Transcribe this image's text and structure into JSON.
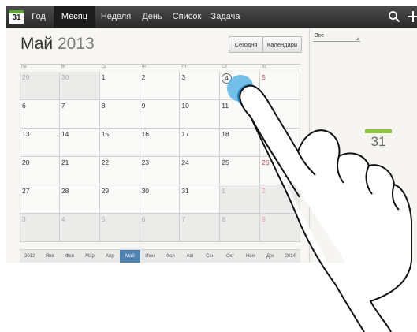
{
  "app": {
    "icon_day": "31"
  },
  "tabs": [
    {
      "label": "Год"
    },
    {
      "label": "Месяц",
      "active": true
    },
    {
      "label": "Неделя"
    },
    {
      "label": "День"
    },
    {
      "label": "Список"
    },
    {
      "label": "Задача"
    }
  ],
  "toolbar": {
    "search_icon": "search-icon",
    "add_icon": "plus-icon"
  },
  "calendar": {
    "month": "Май",
    "year": "2013",
    "today_button": "Сегодня",
    "calendars_button": "Календари",
    "weekdays": [
      "Пн",
      "Вт",
      "Ср",
      "Чт",
      "Пт",
      "Сб",
      "Вс"
    ],
    "weeks": [
      [
        {
          "d": "29",
          "other": true
        },
        {
          "d": "30",
          "other": true
        },
        {
          "d": "1"
        },
        {
          "d": "2"
        },
        {
          "d": "3"
        },
        {
          "d": "4",
          "today": true
        },
        {
          "d": "5",
          "sunday": true
        }
      ],
      [
        {
          "d": "6"
        },
        {
          "d": "7"
        },
        {
          "d": "8"
        },
        {
          "d": "9"
        },
        {
          "d": "10"
        },
        {
          "d": "11"
        },
        {
          "d": "12",
          "sunday": true
        }
      ],
      [
        {
          "d": "13"
        },
        {
          "d": "14"
        },
        {
          "d": "15"
        },
        {
          "d": "16"
        },
        {
          "d": "17"
        },
        {
          "d": "18"
        },
        {
          "d": "19",
          "sunday": true
        }
      ],
      [
        {
          "d": "20"
        },
        {
          "d": "21"
        },
        {
          "d": "22"
        },
        {
          "d": "23"
        },
        {
          "d": "24"
        },
        {
          "d": "25"
        },
        {
          "d": "26",
          "sunday": true
        }
      ],
      [
        {
          "d": "27"
        },
        {
          "d": "28"
        },
        {
          "d": "29"
        },
        {
          "d": "30"
        },
        {
          "d": "31"
        },
        {
          "d": "1",
          "other": true
        },
        {
          "d": "2",
          "other": true,
          "sunday": true
        }
      ],
      [
        {
          "d": "3",
          "other": true
        },
        {
          "d": "4",
          "other": true
        },
        {
          "d": "5",
          "other": true
        },
        {
          "d": "6",
          "other": true
        },
        {
          "d": "7",
          "other": true
        },
        {
          "d": "8",
          "other": true
        },
        {
          "d": "9",
          "other": true,
          "sunday": true
        }
      ]
    ],
    "month_strip": [
      "2012",
      "Янв",
      "Фев",
      "Мар",
      "Апр",
      "Май",
      "Июн",
      "Июл",
      "Авг",
      "Сен",
      "Окт",
      "Ноя",
      "Дек",
      "2014"
    ],
    "month_strip_active": "Май"
  },
  "right_panel": {
    "filter_value": "Все",
    "empty_icon_day": "31"
  },
  "colors": {
    "accent_blue": "#4e82b1",
    "tap_highlight": "#2e9bd6",
    "sunday_red": "#c0455b",
    "calendar_green": "#8dc63f"
  }
}
